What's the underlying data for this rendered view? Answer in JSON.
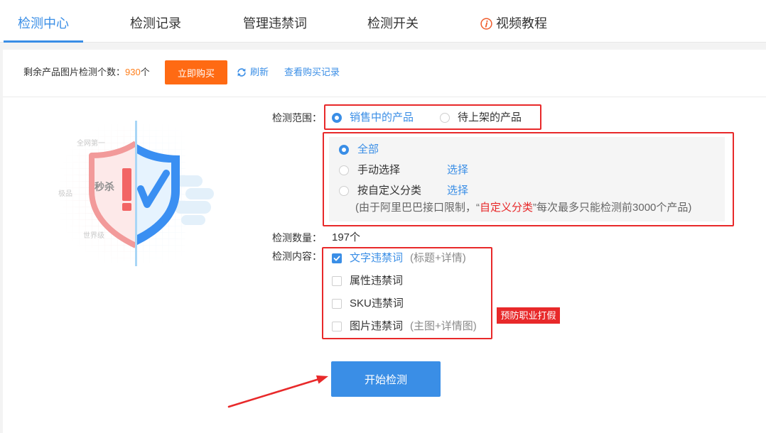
{
  "tabs": [
    {
      "label": "检测中心",
      "active": true
    },
    {
      "label": "检测记录",
      "active": false
    },
    {
      "label": "管理违禁词",
      "active": false
    },
    {
      "label": "检测开关",
      "active": false
    },
    {
      "label": "视频教程",
      "active": false,
      "icon": "info-circle-icon"
    }
  ],
  "quota": {
    "label": "剩余产品图片检测个数：",
    "count": "930",
    "unit": "个"
  },
  "toolbar": {
    "buy_label": "立即购买",
    "refresh_icon": "refresh-icon",
    "refresh_label": "刷新",
    "history_label": "查看购买记录"
  },
  "illustration": {
    "icon": "shield-check-icon",
    "texts": [
      "全网第一",
      "秒杀",
      "极品",
      "世界级"
    ]
  },
  "scope": {
    "label": "检测范围：",
    "options": [
      {
        "label": "销售中的产品",
        "selected": true
      },
      {
        "label": "待上架的产品",
        "selected": false
      }
    ],
    "sub_options": [
      {
        "label": "全部",
        "selected": true
      },
      {
        "label": "手动选择",
        "selected": false,
        "action": "选择"
      },
      {
        "label": "按自定义分类",
        "selected": false,
        "action": "选择"
      }
    ],
    "note": {
      "prefix": "(由于阿里巴巴接口限制，“",
      "highlight": "自定义分类",
      "suffix": "”每次最多只能检测前3000个产品)"
    }
  },
  "quantity": {
    "label": "检测数量：",
    "value": "197个"
  },
  "content": {
    "label": "检测内容：",
    "items": [
      {
        "label": "文字违禁词",
        "hint": "(标题+详情)",
        "checked": true
      },
      {
        "label": "属性违禁词",
        "checked": false
      },
      {
        "label": "SKU违禁词",
        "checked": false
      },
      {
        "label": "图片违禁词",
        "hint": "(主图+详情图)",
        "checked": false
      }
    ],
    "tag": "预防职业打假"
  },
  "start_button": "开始检测",
  "colors": {
    "accent": "#3a8ee6",
    "buy_button": "#ff6a13",
    "count": "#ff7e1a",
    "annotation_red": "#e8292a",
    "info_icon": "#f05c2c"
  }
}
